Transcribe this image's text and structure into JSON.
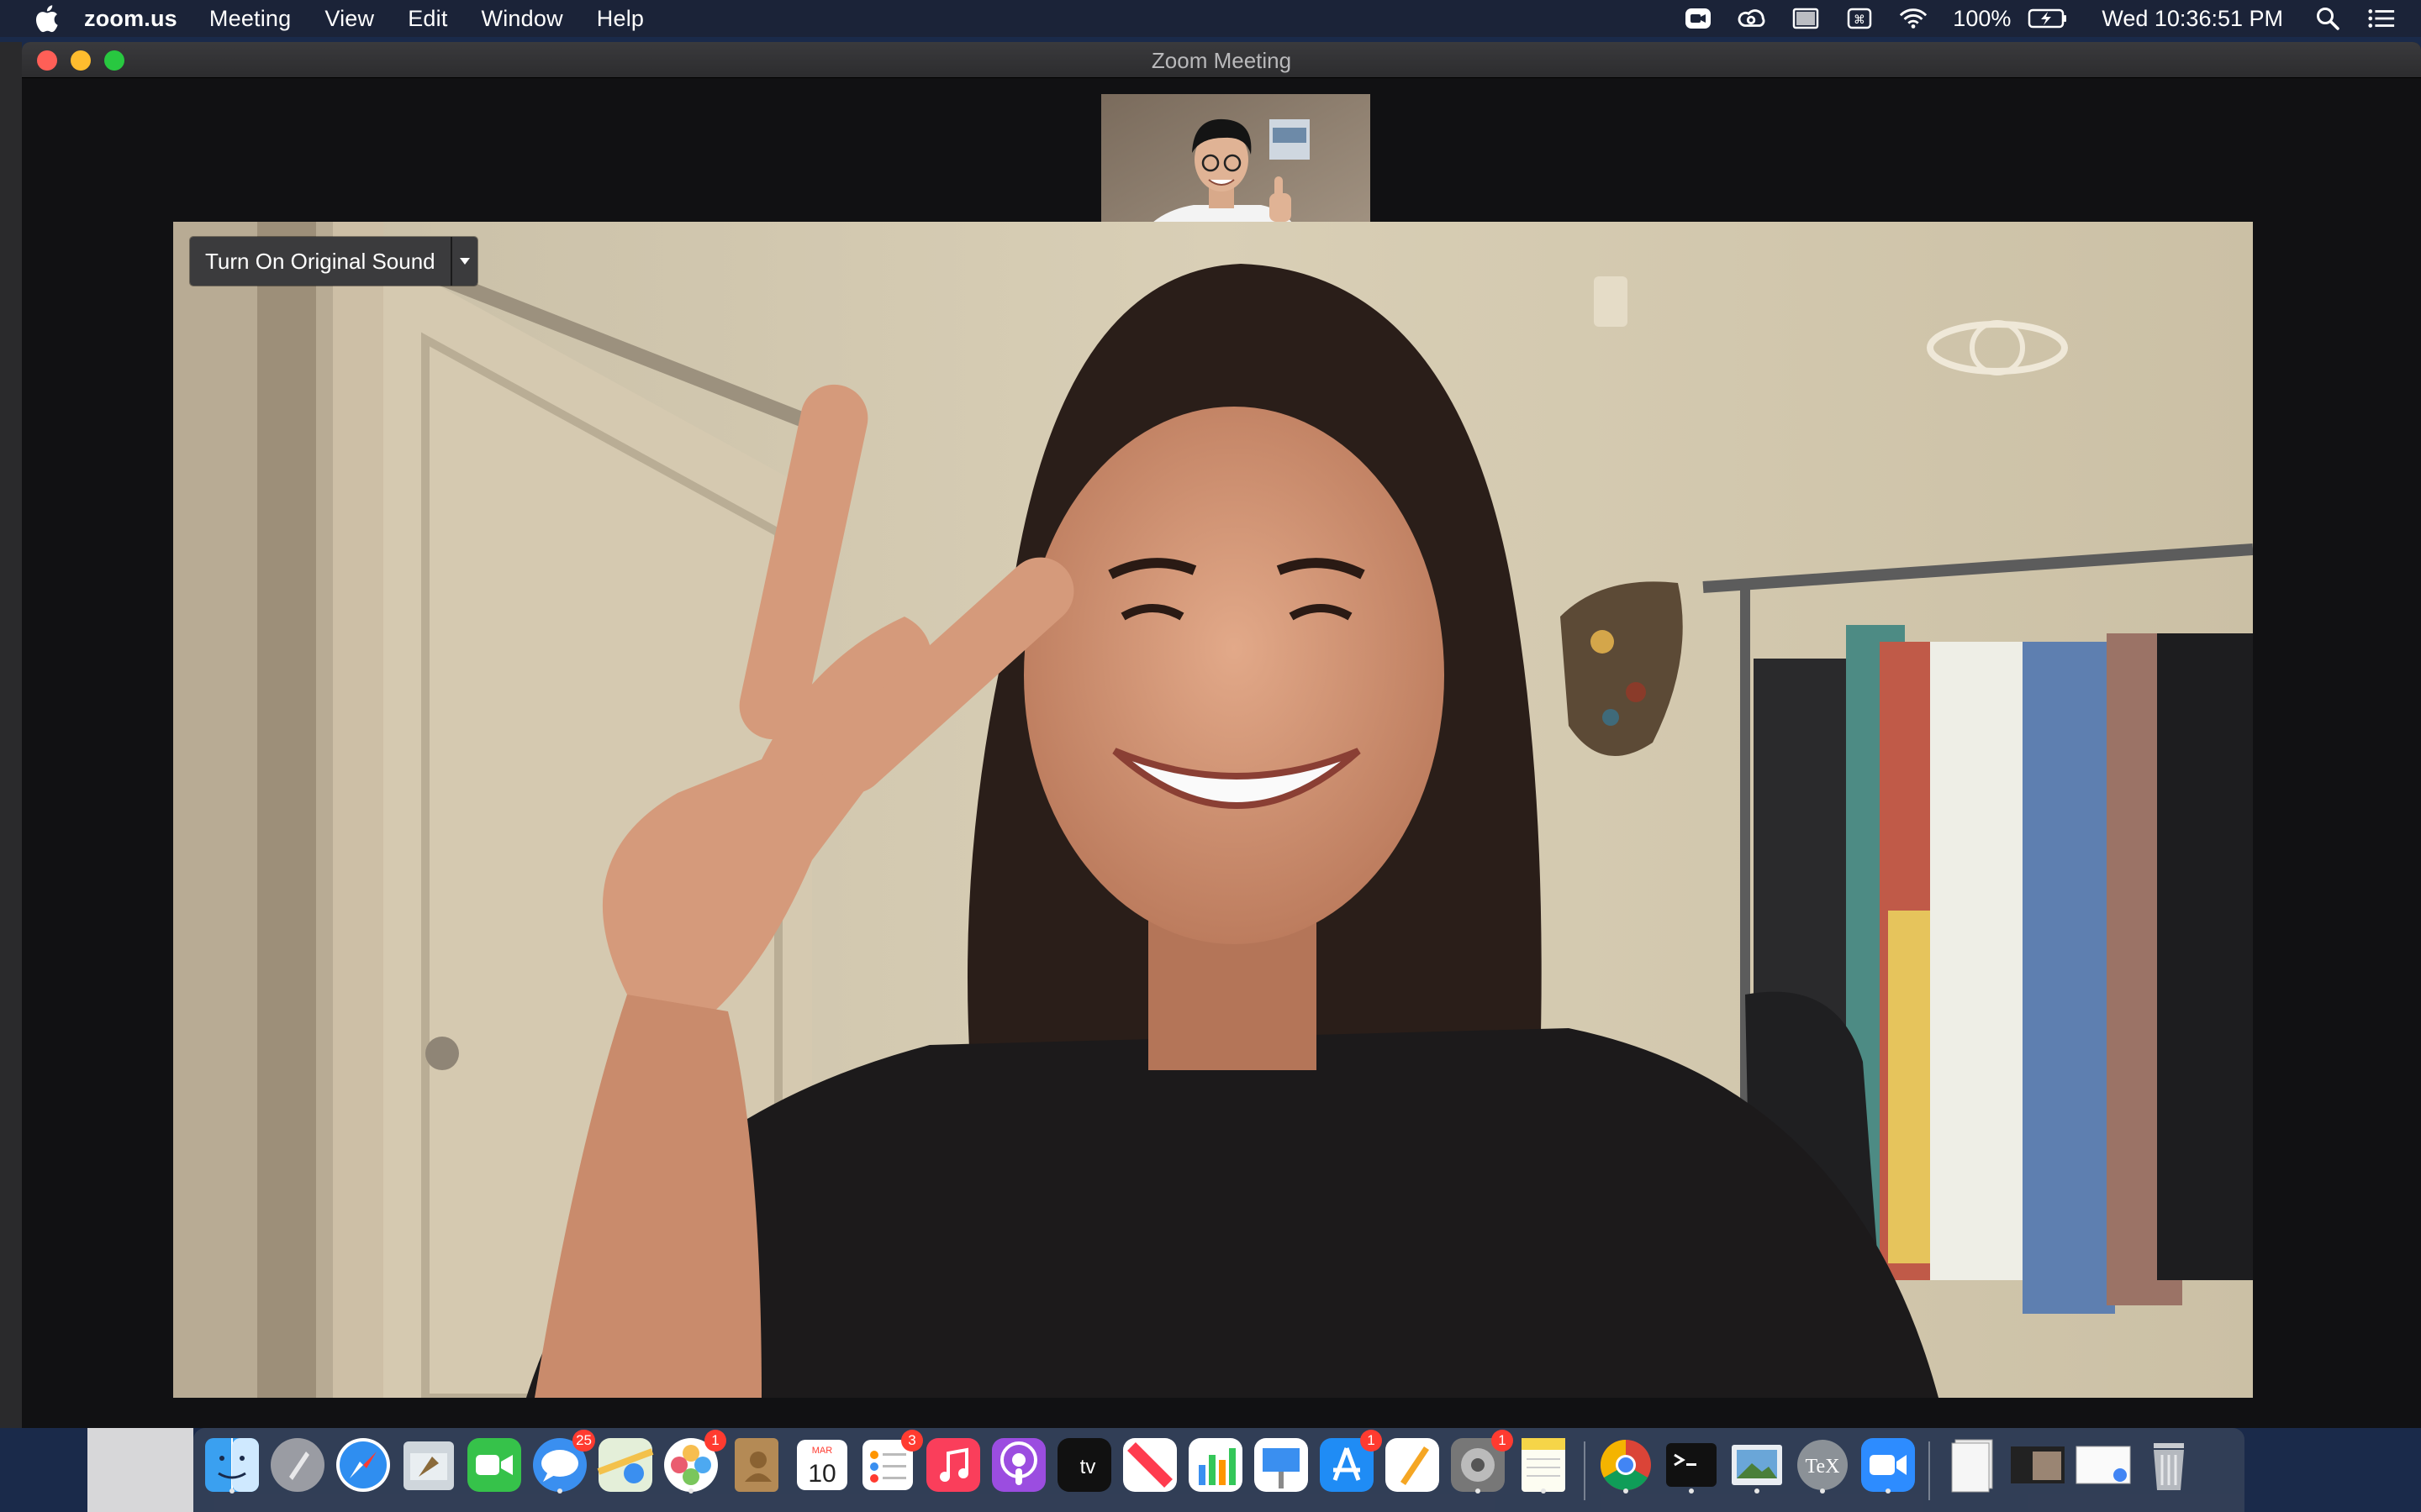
{
  "menubar": {
    "app_name": "zoom.us",
    "menus": [
      "Meeting",
      "View",
      "Edit",
      "Window",
      "Help"
    ],
    "battery": "100%",
    "clock": "Wed 10:36:51 PM",
    "status_icons": [
      "zoom-status-icon",
      "creative-cloud-icon",
      "display-icon",
      "keyboard-icon",
      "wifi-icon",
      "battery-icon",
      "spotlight-icon",
      "notification-center-icon"
    ]
  },
  "window": {
    "title": "Zoom Meeting"
  },
  "video": {
    "original_sound_button": "Turn On Original Sound"
  },
  "dock": {
    "items": [
      {
        "name": "finder-icon",
        "running": true
      },
      {
        "name": "launchpad-icon",
        "running": false
      },
      {
        "name": "safari-icon",
        "running": false
      },
      {
        "name": "mail-icon",
        "running": false
      },
      {
        "name": "facetime-icon",
        "running": false
      },
      {
        "name": "messages-icon",
        "running": true,
        "badge": "25"
      },
      {
        "name": "maps-icon",
        "running": false
      },
      {
        "name": "photos-icon",
        "running": true,
        "badge": "1"
      },
      {
        "name": "contacts-icon",
        "running": false
      },
      {
        "name": "calendar-icon",
        "running": false,
        "month": "MAR",
        "day": "10"
      },
      {
        "name": "reminders-icon",
        "running": false,
        "badge": "3"
      },
      {
        "name": "music-icon",
        "running": false
      },
      {
        "name": "podcasts-icon",
        "running": false
      },
      {
        "name": "apple-tv-icon",
        "running": false,
        "label": "tv"
      },
      {
        "name": "news-icon",
        "running": false
      },
      {
        "name": "numbers-icon",
        "running": false
      },
      {
        "name": "keynote-icon",
        "running": false
      },
      {
        "name": "app-store-icon",
        "running": false,
        "badge": "1"
      },
      {
        "name": "pages-icon",
        "running": false
      },
      {
        "name": "system-preferences-icon",
        "running": true,
        "badge": "1"
      },
      {
        "name": "notes-icon",
        "running": true
      },
      {
        "name": "chrome-icon",
        "running": true
      },
      {
        "name": "terminal-icon",
        "running": true
      },
      {
        "name": "preview-icon",
        "running": true
      },
      {
        "name": "texshop-icon",
        "running": true,
        "label": "TeX"
      },
      {
        "name": "zoom-icon",
        "running": true
      },
      {
        "name": "documents-stack-icon",
        "running": false
      },
      {
        "name": "window-thumbnail-zoom-icon",
        "running": false
      },
      {
        "name": "window-thumbnail-browser-icon",
        "running": false
      },
      {
        "name": "trash-icon",
        "running": false
      }
    ]
  },
  "colors": {
    "menubar": "#1b2338",
    "window_bg": "#111113",
    "close": "#ff5f57",
    "minimize": "#febc2e",
    "zoom": "#28c840",
    "badge": "#ff3b30"
  }
}
